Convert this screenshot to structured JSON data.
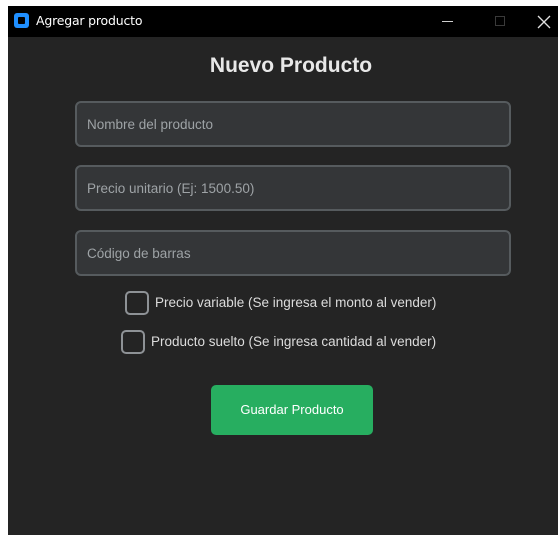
{
  "window": {
    "title": "Agregar producto",
    "icon": "app-icon"
  },
  "form": {
    "heading": "Nuevo Producto",
    "fields": [
      {
        "name": "nombre",
        "value": "",
        "placeholder": "Nombre del producto"
      },
      {
        "name": "precio",
        "value": "",
        "placeholder": "Precio unitario (Ej: 1500.50)"
      },
      {
        "name": "codigo",
        "value": "",
        "placeholder": "Código de barras"
      }
    ],
    "checkboxes": [
      {
        "label": "Precio variable (Se ingresa el monto al vender)",
        "checked": false
      },
      {
        "label": "Producto suelto (Se ingresa cantidad al vender)",
        "checked": false
      }
    ],
    "save_label": "Guardar Producto"
  },
  "colors": {
    "background": "#242424",
    "titlebar": "#000000",
    "field_bg": "#343638",
    "field_border": "#565b5e",
    "accent_green": "#27ae60",
    "app_icon_blue": "#1f8fff"
  }
}
